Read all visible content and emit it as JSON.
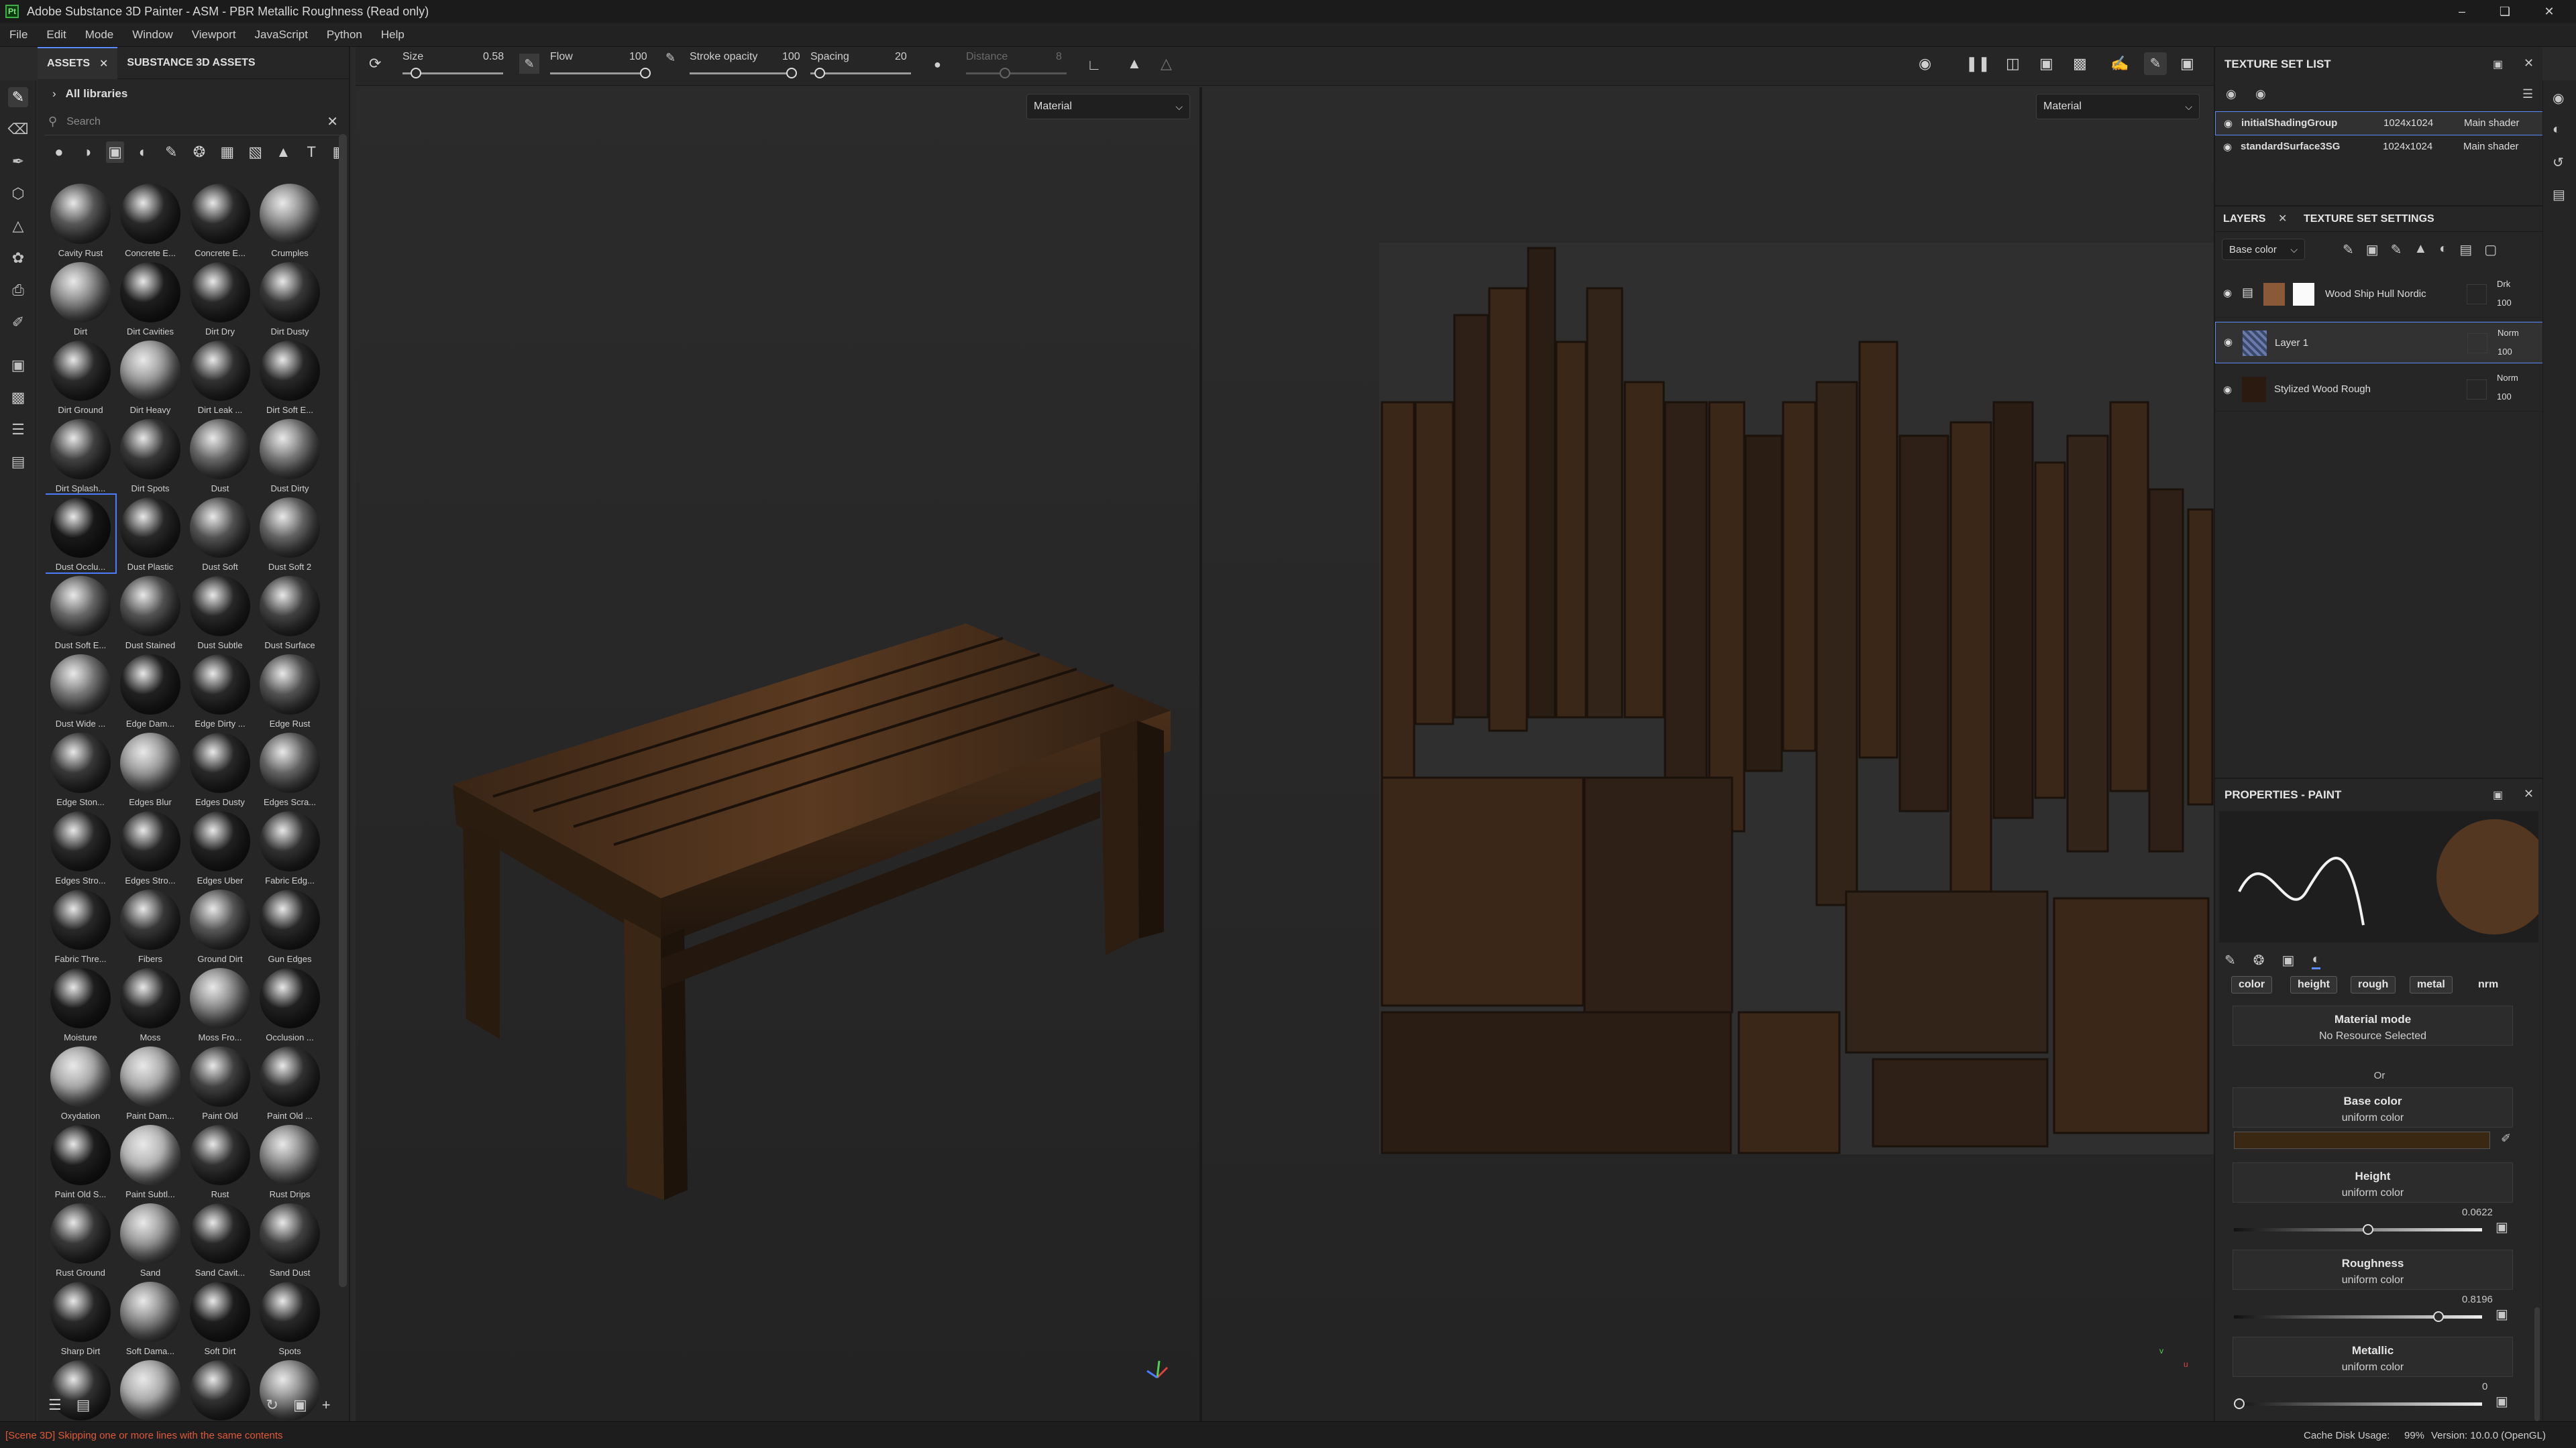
{
  "window": {
    "title": "Adobe Substance 3D Painter - ASM - PBR Metallic Roughness (Read only)",
    "app_icon_text": "Pt",
    "controls": [
      "minimize",
      "maximize",
      "close"
    ]
  },
  "menu": [
    "File",
    "Edit",
    "Mode",
    "Window",
    "Viewport",
    "JavaScript",
    "Python",
    "Help"
  ],
  "tools": [
    "paint-brush",
    "eraser",
    "projection",
    "geometry-mask",
    "polygon-fill",
    "smudge",
    "clone",
    "color-picker",
    "bake",
    "layer-instance",
    "iray",
    "export"
  ],
  "assets": {
    "tabs": [
      "ASSETS",
      "SUBSTANCE 3D ASSETS"
    ],
    "library": "All libraries",
    "search_placeholder": "Search",
    "filter_icons": [
      "material",
      "smart-material",
      "smart-mask",
      "filter",
      "brush",
      "particles",
      "alpha",
      "procedural",
      "environment",
      "text",
      "all"
    ],
    "items": [
      {
        "label": "Cavity Rust",
        "tone": "#5a5a5a"
      },
      {
        "label": "Concrete E...",
        "tone": "#2a2a2a"
      },
      {
        "label": "Concrete E...",
        "tone": "#2e2e2e"
      },
      {
        "label": "Crumples",
        "tone": "#8a8a8a"
      },
      {
        "label": "Dirt",
        "tone": "#8a8a8a"
      },
      {
        "label": "Dirt Cavities",
        "tone": "#1f1f1f"
      },
      {
        "label": "Dirt Dry",
        "tone": "#2a2a2a"
      },
      {
        "label": "Dirt Dusty",
        "tone": "#3a3a3a"
      },
      {
        "label": "Dirt Ground",
        "tone": "#2d2d2d"
      },
      {
        "label": "Dirt Heavy",
        "tone": "#9a9a9a"
      },
      {
        "label": "Dirt Leak ...",
        "tone": "#333"
      },
      {
        "label": "Dirt Soft E...",
        "tone": "#2a2a2a"
      },
      {
        "label": "Dirt Splash...",
        "tone": "#444"
      },
      {
        "label": "Dirt Spots",
        "tone": "#3a3a3a"
      },
      {
        "label": "Dust",
        "tone": "#6a6a6a"
      },
      {
        "label": "Dust Dirty",
        "tone": "#7a7a7a"
      },
      {
        "label": "Dust Occlu...",
        "tone": "#1a1a1a"
      },
      {
        "label": "Dust Plastic",
        "tone": "#2a2a2a"
      },
      {
        "label": "Dust Soft",
        "tone": "#555"
      },
      {
        "label": "Dust Soft 2",
        "tone": "#666"
      },
      {
        "label": "Dust Soft E...",
        "tone": "#6a6a6a"
      },
      {
        "label": "Dust Stained",
        "tone": "#555"
      },
      {
        "label": "Dust Subtle",
        "tone": "#2a2a2a"
      },
      {
        "label": "Dust Surface",
        "tone": "#444"
      },
      {
        "label": "Dust Wide ...",
        "tone": "#7a7a7a"
      },
      {
        "label": "Edge Dam...",
        "tone": "#222"
      },
      {
        "label": "Edge Dirty ...",
        "tone": "#2a2a2a"
      },
      {
        "label": "Edge Rust",
        "tone": "#555"
      },
      {
        "label": "Edge Ston...",
        "tone": "#3a3a3a"
      },
      {
        "label": "Edges Blur",
        "tone": "#9a9a9a"
      },
      {
        "label": "Edges Dusty",
        "tone": "#2a2a2a"
      },
      {
        "label": "Edges Scra...",
        "tone": "#666"
      },
      {
        "label": "Edges Stro...",
        "tone": "#2a2a2a"
      },
      {
        "label": "Edges Stro...",
        "tone": "#2a2a2a"
      },
      {
        "label": "Edges Uber",
        "tone": "#222"
      },
      {
        "label": "Fabric Edg...",
        "tone": "#333"
      },
      {
        "label": "Fabric Thre...",
        "tone": "#2a2a2a"
      },
      {
        "label": "Fibers",
        "tone": "#3a3a3a"
      },
      {
        "label": "Ground Dirt",
        "tone": "#5a5a5a"
      },
      {
        "label": "Gun Edges",
        "tone": "#2a2a2a"
      },
      {
        "label": "Moisture",
        "tone": "#1f1f1f"
      },
      {
        "label": "Moss",
        "tone": "#2a2a2a"
      },
      {
        "label": "Moss Fro...",
        "tone": "#8a8a8a"
      },
      {
        "label": "Occlusion ...",
        "tone": "#222"
      },
      {
        "label": "Oxydation",
        "tone": "#aaa"
      },
      {
        "label": "Paint Dam...",
        "tone": "#aaa"
      },
      {
        "label": "Paint Old",
        "tone": "#444"
      },
      {
        "label": "Paint Old ...",
        "tone": "#333"
      },
      {
        "label": "Paint Old S...",
        "tone": "#1f1f1f"
      },
      {
        "label": "Paint Subtl...",
        "tone": "#b5b5b5"
      },
      {
        "label": "Rust",
        "tone": "#333"
      },
      {
        "label": "Rust Drips",
        "tone": "#888"
      },
      {
        "label": "Rust Ground",
        "tone": "#3a3a3a"
      },
      {
        "label": "Sand",
        "tone": "#999"
      },
      {
        "label": "Sand Cavit...",
        "tone": "#2a2a2a"
      },
      {
        "label": "Sand Dust",
        "tone": "#444"
      },
      {
        "label": "Sharp Dirt",
        "tone": "#2a2a2a"
      },
      {
        "label": "Soft Dama...",
        "tone": "#8a8a8a"
      },
      {
        "label": "Soft Dirt",
        "tone": "#1f1f1f"
      },
      {
        "label": "Spots",
        "tone": "#2a2a2a"
      },
      {
        "label": "",
        "tone": "#333"
      },
      {
        "label": "",
        "tone": "#aaa"
      },
      {
        "label": "",
        "tone": "#333"
      },
      {
        "label": "",
        "tone": "#888"
      }
    ],
    "selected_index": 16
  },
  "brush_toolbar": {
    "size_label": "Size",
    "size_value": "0.58",
    "flow_label": "Flow",
    "flow_value": "100",
    "stroke_opacity_label": "Stroke opacity",
    "stroke_opacity_value": "100",
    "spacing_label": "Spacing",
    "spacing_value": "20",
    "distance_label": "Distance",
    "distance_value": "8"
  },
  "viewport": {
    "mode_3d": "Material",
    "mode_2d": "Material",
    "axis_3d": {
      "x": "x",
      "y": "y",
      "z": "z"
    },
    "axis_2d": {
      "u": "u",
      "v": "v"
    }
  },
  "texture_set_list": {
    "title": "TEXTURE SET LIST",
    "rows": [
      {
        "name": "initialShadingGroup",
        "res": "1024x1024",
        "shader": "Main shader",
        "selected": true
      },
      {
        "name": "standardSurface3SG",
        "res": "1024x1024",
        "shader": "Main shader",
        "selected": false
      }
    ]
  },
  "layers": {
    "tabs": [
      "LAYERS",
      "TEXTURE SET SETTINGS"
    ],
    "channel": "Base color",
    "items": [
      {
        "name": "Wood Ship Hull Nordic",
        "blend": "Drk",
        "opacity": "100",
        "type": "folder"
      },
      {
        "name": "Layer 1",
        "blend": "Norm",
        "opacity": "100",
        "type": "paint"
      },
      {
        "name": "Stylized Wood Rough",
        "blend": "Norm",
        "opacity": "100",
        "type": "fill"
      }
    ],
    "selected_index": 1
  },
  "properties": {
    "title": "PROPERTIES - PAINT",
    "channels": [
      "color",
      "height",
      "rough",
      "metal",
      "nrm"
    ],
    "material_mode": "Material mode",
    "material_mode_sub": "No Resource Selected",
    "or_label": "Or",
    "base_color": {
      "title": "Base color",
      "sub": "uniform color",
      "swatch": "#3a2812"
    },
    "height": {
      "title": "Height",
      "sub": "uniform color",
      "value": "0.0622",
      "fraction": 0.53
    },
    "roughness": {
      "title": "Roughness",
      "sub": "uniform color",
      "value": "0.8196",
      "fraction": 0.82
    },
    "metallic": {
      "title": "Metallic",
      "sub": "uniform color",
      "value": "0",
      "fraction": 0.0
    }
  },
  "status": {
    "left": "[Scene 3D] Skipping one or more lines with the same contents",
    "cache_label": "Cache Disk Usage:",
    "cache_value": "99%",
    "version": "Version: 10.0.0 (OpenGL)"
  }
}
